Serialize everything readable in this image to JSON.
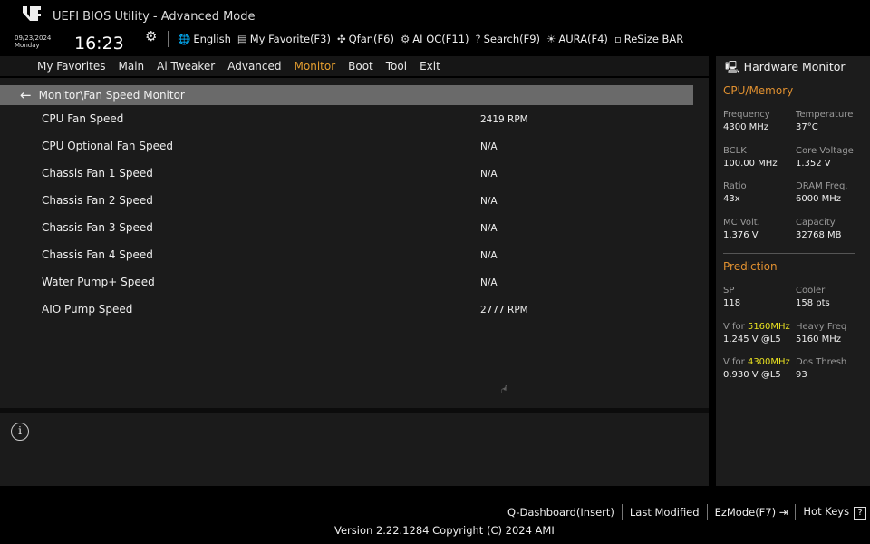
{
  "header": {
    "title": "UEFI BIOS Utility - Advanced Mode",
    "date": "09/23/2024",
    "day": "Monday",
    "time": "16:23",
    "tools": [
      {
        "icon": "globe-icon",
        "glyph": "🌐",
        "label": "English"
      },
      {
        "icon": "favorite-icon",
        "glyph": "▤",
        "label": "My Favorite(F3)"
      },
      {
        "icon": "fan-icon",
        "glyph": "✣",
        "label": "Qfan(F6)"
      },
      {
        "icon": "ai-oc-icon",
        "glyph": "⚙",
        "label": "AI OC(F11)"
      },
      {
        "icon": "search-help-icon",
        "glyph": "?",
        "label": "Search(F9)"
      },
      {
        "icon": "aura-icon",
        "glyph": "☀",
        "label": "AURA(F4)"
      },
      {
        "icon": "resize-bar-icon",
        "glyph": "▫",
        "label": "ReSize BAR"
      }
    ]
  },
  "menu": {
    "tabs": [
      "My Favorites",
      "Main",
      "Ai Tweaker",
      "Advanced",
      "Monitor",
      "Boot",
      "Tool",
      "Exit"
    ],
    "active": "Monitor"
  },
  "breadcrumb": "Monitor\\Fan Speed Monitor",
  "rows": [
    {
      "label": "CPU Fan Speed",
      "value": "2419 RPM"
    },
    {
      "label": "CPU Optional Fan Speed",
      "value": "N/A"
    },
    {
      "label": "Chassis Fan 1 Speed",
      "value": "N/A"
    },
    {
      "label": "Chassis Fan 2 Speed",
      "value": "N/A"
    },
    {
      "label": "Chassis Fan 3 Speed",
      "value": "N/A"
    },
    {
      "label": "Chassis Fan 4 Speed",
      "value": "N/A"
    },
    {
      "label": "Water Pump+ Speed",
      "value": "N/A"
    },
    {
      "label": "AIO Pump Speed",
      "value": "2777 RPM"
    }
  ],
  "hw": {
    "title": "Hardware Monitor",
    "cpu_section": "CPU/Memory",
    "cpu": [
      {
        "label": "Frequency",
        "value": "4300 MHz"
      },
      {
        "label": "Temperature",
        "value": "37°C"
      },
      {
        "label": "BCLK",
        "value": "100.00 MHz"
      },
      {
        "label": "Core Voltage",
        "value": "1.352 V"
      },
      {
        "label": "Ratio",
        "value": "43x"
      },
      {
        "label": "DRAM Freq.",
        "value": "6000 MHz"
      },
      {
        "label": "MC Volt.",
        "value": "1.376 V"
      },
      {
        "label": "Capacity",
        "value": "32768 MB"
      }
    ],
    "pred_section": "Prediction",
    "pred": [
      {
        "label": "SP",
        "value": "118"
      },
      {
        "label": "Cooler",
        "value": "158 pts"
      },
      {
        "label": "V for ",
        "hl": "5160MHz",
        "value": "1.245 V @L5"
      },
      {
        "label": "Heavy Freq",
        "value": "5160 MHz"
      },
      {
        "label": "V for ",
        "hl": "4300MHz",
        "value": "0.930 V @L5"
      },
      {
        "label": "Dos Thresh",
        "value": "93"
      }
    ]
  },
  "footer": {
    "items": [
      "Q-Dashboard(Insert)",
      "Last Modified",
      "EzMode(F7)",
      "Hot Keys"
    ],
    "version": "Version 2.22.1284 Copyright (C) 2024 AMI"
  },
  "colors": {
    "accent": "#e09030",
    "highlight": "#e8e020",
    "breadcrumb_bg": "#6a6a6a"
  }
}
